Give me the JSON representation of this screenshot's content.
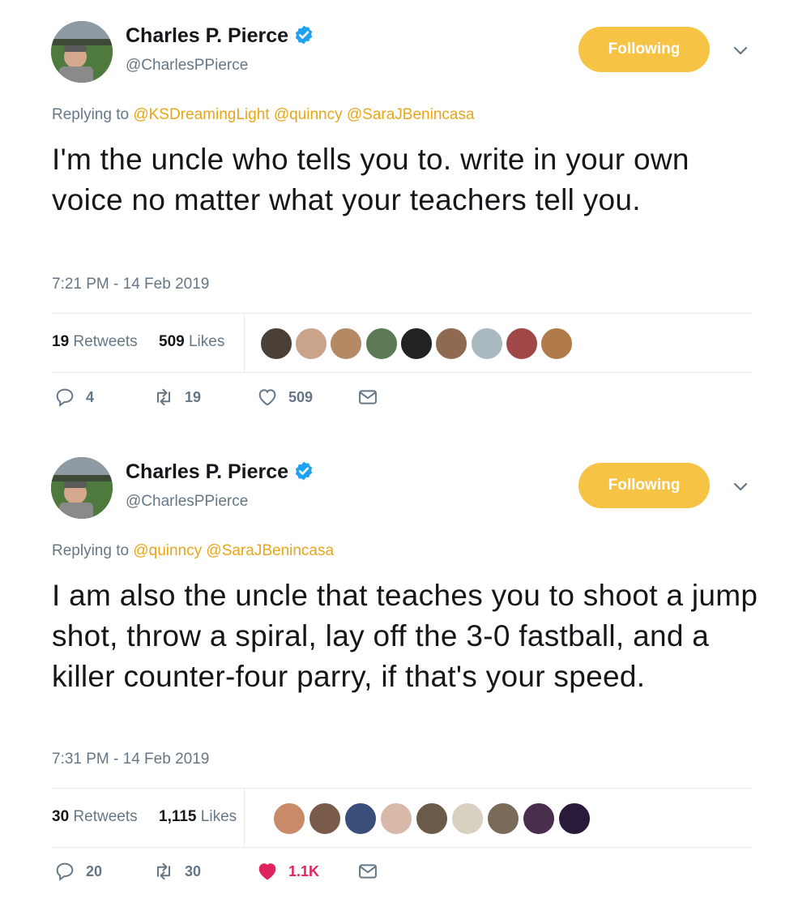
{
  "tweets": [
    {
      "name": "Charles P. Pierce",
      "handle": "@CharlesPPierce",
      "follow_label": "Following",
      "replying_prefix": "Replying to",
      "mentions": [
        "@KSDreamingLight",
        "@quinncy",
        "@SaraJBenincasa"
      ],
      "text": "I'm the uncle who tells you to. write in your own voice no matter what your teachers tell you.",
      "timestamp": "7:21 PM - 14 Feb 2019",
      "retweets_count": "19",
      "retweets_label": "Retweets",
      "likes_count": "509",
      "likes_label": "Likes",
      "replies": "4",
      "retweets": "19",
      "likes": "509",
      "liked": false,
      "liker_colors": [
        "#4a4038",
        "#c9a38a",
        "#b38a64",
        "#5c7a56",
        "#222222",
        "#8f6a52",
        "#aab8c2",
        "#a04848",
        "#b07a4a"
      ]
    },
    {
      "name": "Charles P. Pierce",
      "handle": "@CharlesPPierce",
      "follow_label": "Following",
      "replying_prefix": "Replying to",
      "mentions": [
        "@quinncy",
        "@SaraJBenincasa"
      ],
      "text": "I am also the uncle that teaches you to shoot a jump shot, throw a spiral, lay off the 3-0 fastball, and a killer counter-four parry, if that's your speed.",
      "timestamp": "7:31 PM - 14 Feb 2019",
      "retweets_count": "30",
      "retweets_label": "Retweets",
      "likes_count": "1,115",
      "likes_label": "Likes",
      "replies": "20",
      "retweets": "30",
      "likes": "1.1K",
      "liked": true,
      "liker_colors": [
        "#c98a6a",
        "#7a5a48",
        "#3a4e7a",
        "#d8b8a8",
        "#6a5a48",
        "#d8d0c0",
        "#7a6a58",
        "#4a2e4e",
        "#2a1a3a"
      ]
    }
  ],
  "colors": {
    "follow_button": "#f6c344",
    "mention": "#e8a617",
    "verified": "#1da1f2",
    "like_active": "#e0245e",
    "secondary_text": "#657786"
  },
  "icons": {
    "reply": "reply-icon",
    "retweet": "retweet-icon",
    "like": "heart-icon",
    "dm": "envelope-icon",
    "verified": "verified-badge-icon",
    "caret": "chevron-down-icon"
  }
}
